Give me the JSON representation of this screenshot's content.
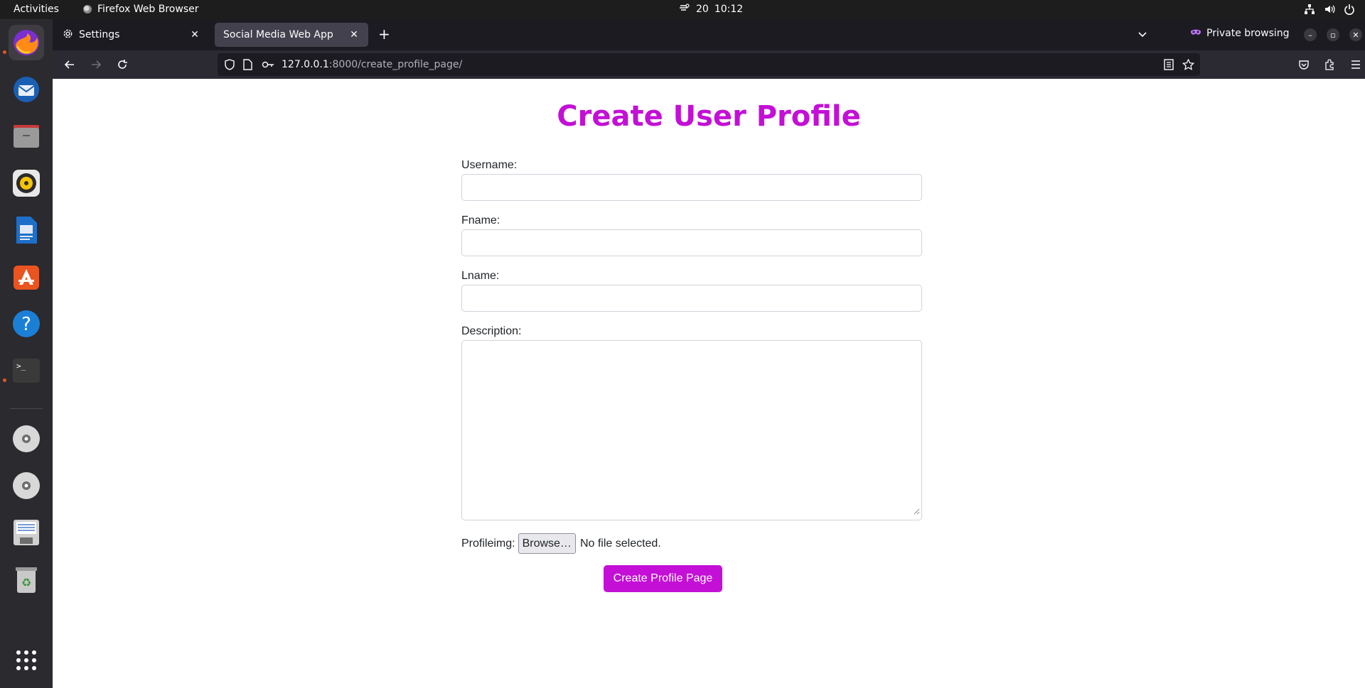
{
  "topbar": {
    "activities": "Activities",
    "app_name": "Firefox Web Browser",
    "weather_temp": "20",
    "time": "10:12"
  },
  "dock": {
    "items": [
      "firefox",
      "thunderbird",
      "files",
      "rhythmbox",
      "libreoffice-writer",
      "app-center",
      "help",
      "terminal",
      "disc-1",
      "disc-2",
      "save-drive",
      "trash",
      "show-apps"
    ]
  },
  "browser": {
    "tabs": [
      {
        "label": "Settings",
        "active": false
      },
      {
        "label": "Social Media Web App",
        "active": true
      }
    ],
    "private_label": "Private browsing",
    "url_host": "127.0.0.1",
    "url_rest": ":8000/create_profile_page/"
  },
  "form": {
    "title": "Create User Profile",
    "username_label": "Username:",
    "username_value": "",
    "fname_label": "Fname:",
    "fname_value": "",
    "lname_label": "Lname:",
    "lname_value": "",
    "description_label": "Description:",
    "description_value": "",
    "profileimg_label": "Profileimg:",
    "browse_label": "Browse…",
    "no_file_text": "No file selected.",
    "submit_label": "Create Profile Page"
  },
  "colors": {
    "accent": "#c30fd6",
    "topbar_bg": "#1d1d1d",
    "dock_bg": "#2b2a2e",
    "tabbar_bg": "#1c1b22",
    "navbar_bg": "#2b2a33"
  }
}
